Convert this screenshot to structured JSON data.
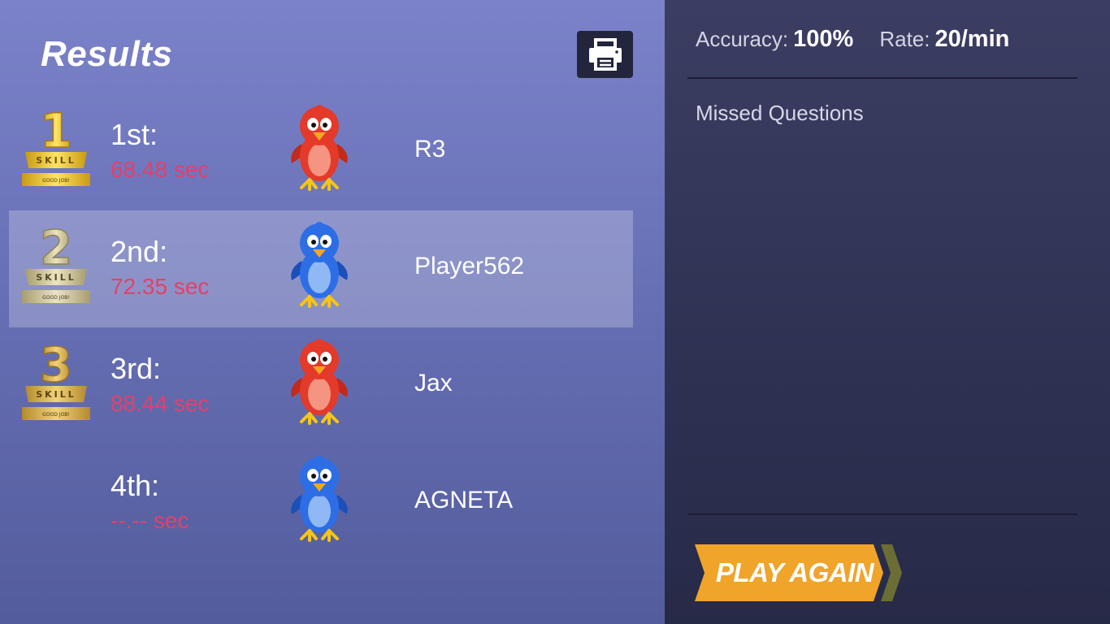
{
  "title": "Results",
  "print_icon": "printer-icon",
  "results": [
    {
      "place": "1st:",
      "time": "68.48 sec",
      "name": "R3",
      "bird_color": "red",
      "trophy_number": "1",
      "trophy_word": "SKILL",
      "trophy_caption": "GOOD JOB!"
    },
    {
      "place": "2nd:",
      "time": "72.35 sec",
      "name": "Player562",
      "bird_color": "blue",
      "trophy_number": "2",
      "trophy_word": "SKILL",
      "trophy_caption": "GOOD JOB!"
    },
    {
      "place": "3rd:",
      "time": "88.44 sec",
      "name": "Jax",
      "bird_color": "red",
      "trophy_number": "3",
      "trophy_word": "SKILL",
      "trophy_caption": "GOOD JOB!"
    },
    {
      "place": "4th:",
      "time": "--.-- sec",
      "name": "AGNETA",
      "bird_color": "blue"
    }
  ],
  "stats": {
    "accuracy_label": "Accuracy:",
    "accuracy_value": "100%",
    "rate_label": "Rate:",
    "rate_value": "20/min"
  },
  "missed_questions_title": "Missed Questions",
  "play_again_label": "PLAY AGAIN",
  "colors": {
    "time_red": "#e3416b",
    "play_again_orange": "#f0a42a",
    "play_again_chevron": "#6b6e34",
    "gold": "#e9c53a",
    "silver": "#c7bd8d",
    "bronze": "#d6b25a",
    "red_bird": "#e33a2a",
    "blue_bird": "#2d6ee6"
  }
}
